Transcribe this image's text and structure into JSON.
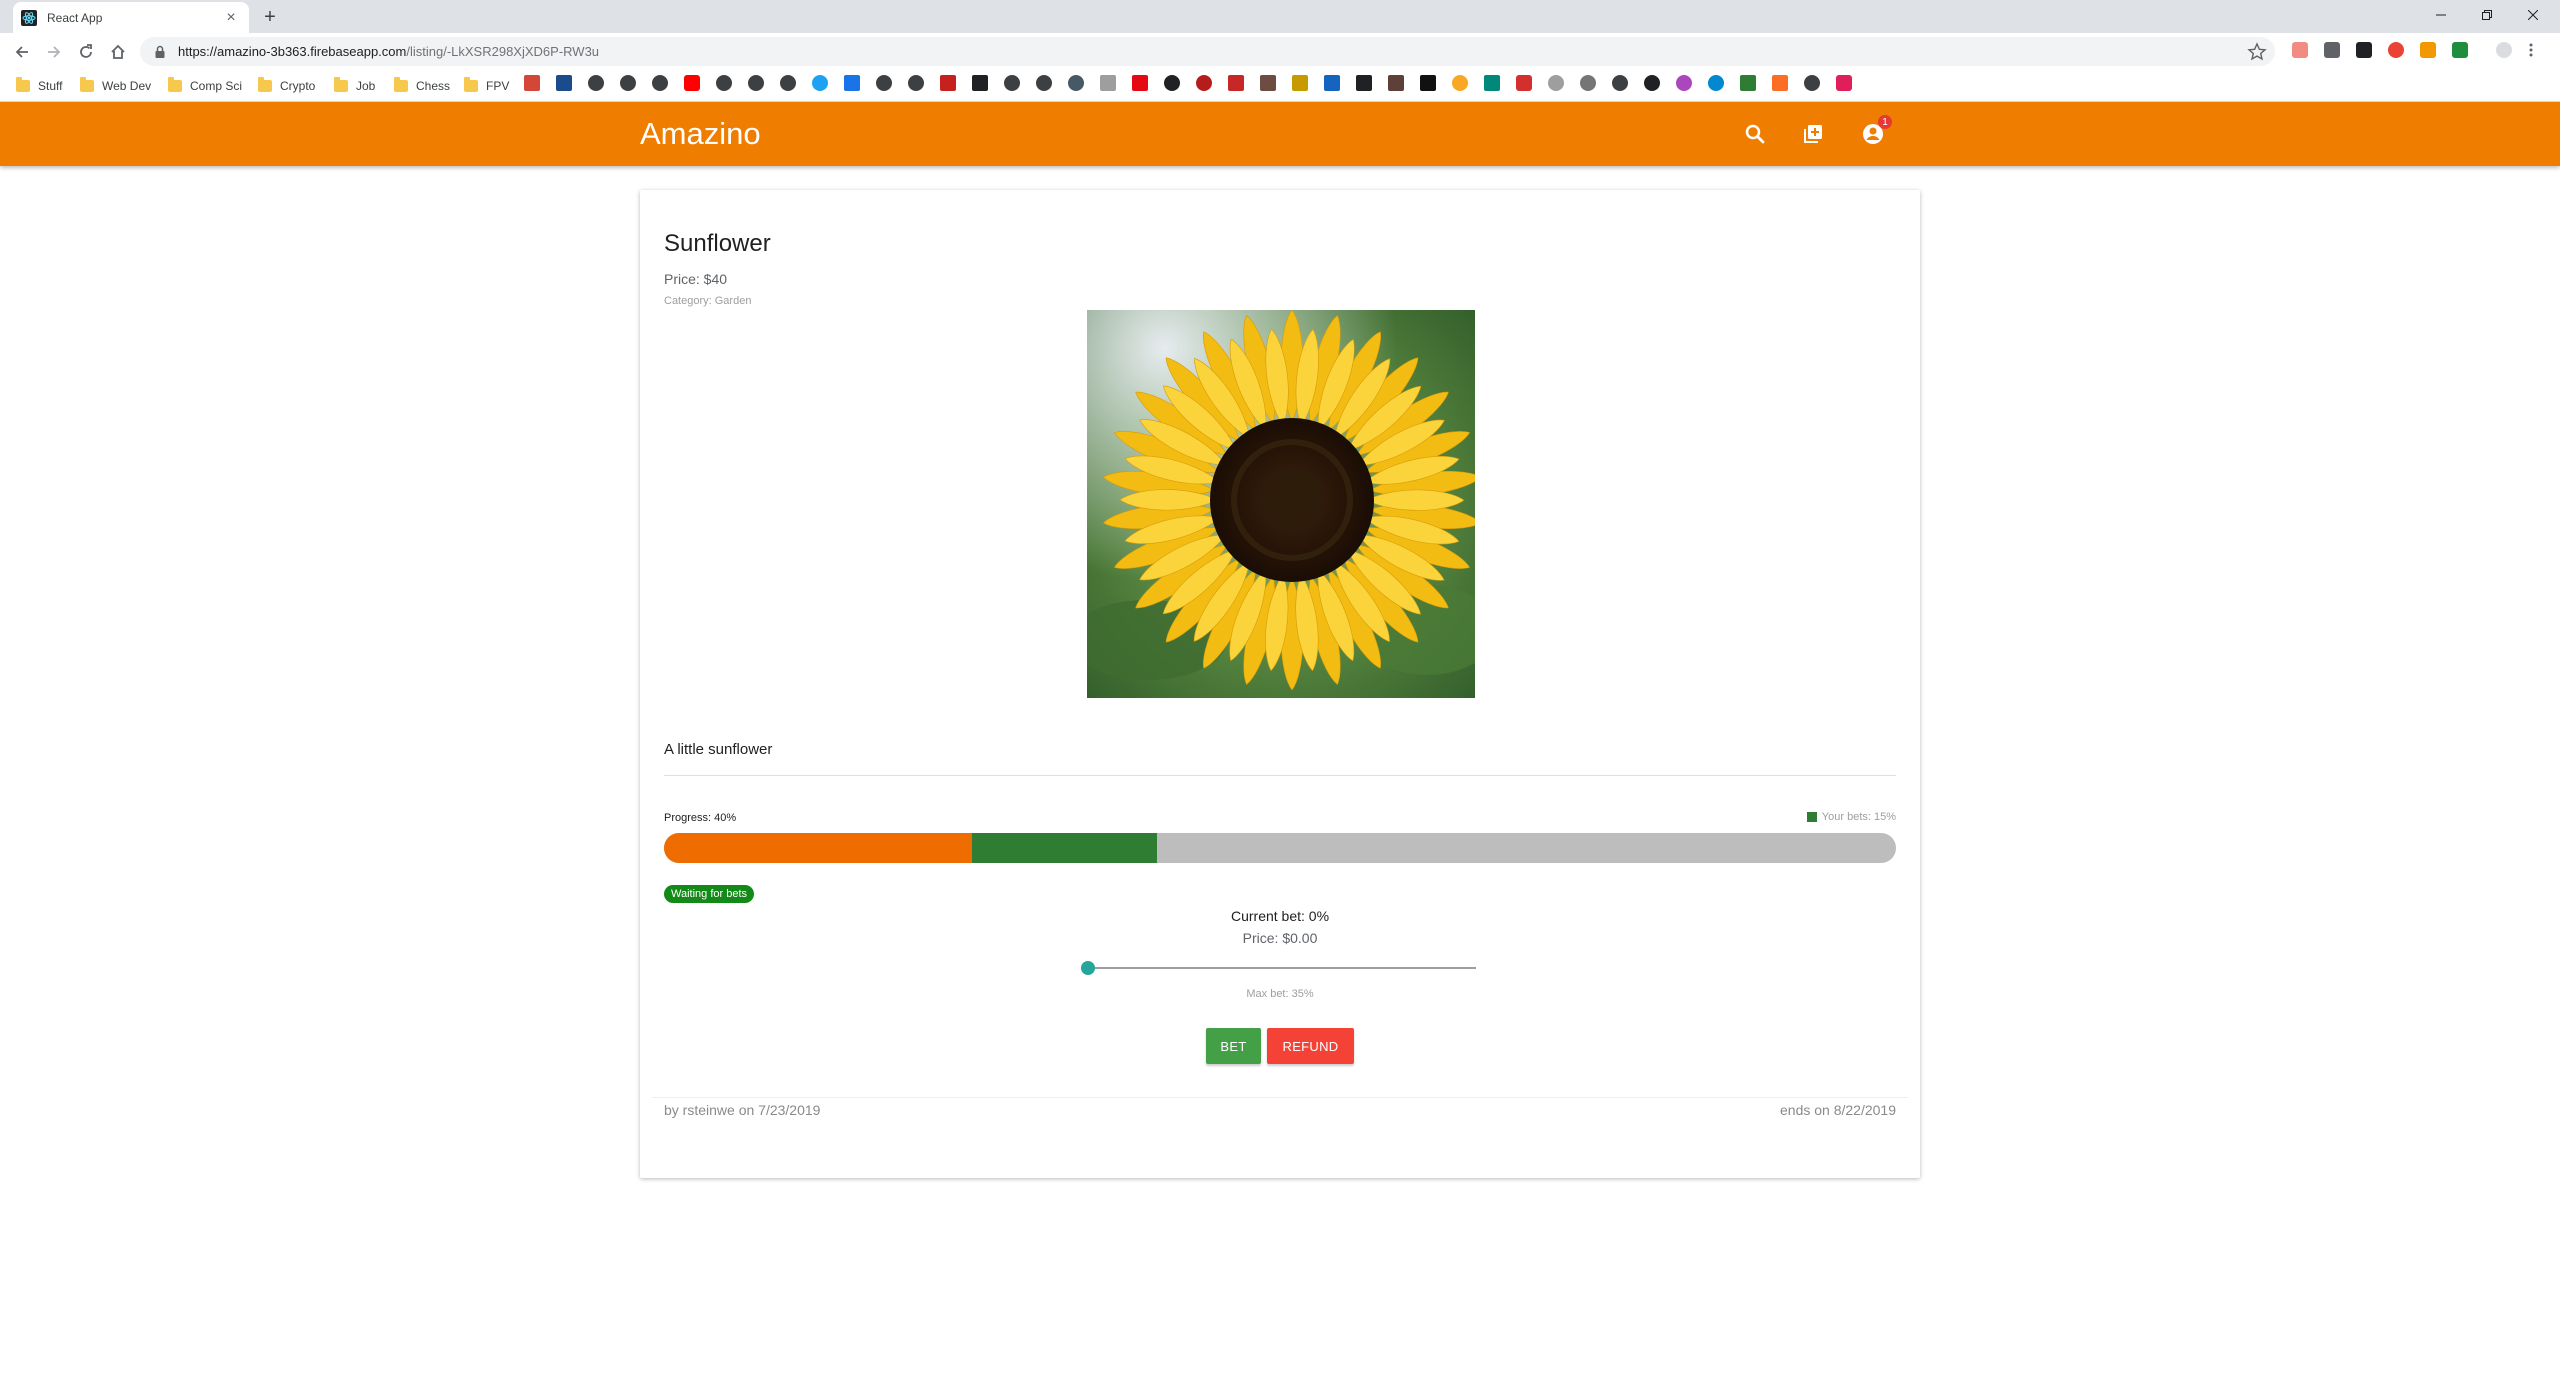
{
  "browser": {
    "tab_title": "React App",
    "tab_close": "×",
    "new_tab": "+",
    "url_host": "https://amazino-3b363.firebaseapp.com",
    "url_path": "/listing/-LkXSR298XjXD6P-RW3u",
    "bookmarks": [
      "Stuff",
      "Web Dev",
      "Comp Sci",
      "Crypto",
      "Job",
      "Chess",
      "FPV"
    ]
  },
  "app": {
    "brand": "Amazino",
    "notification_count": "1",
    "colors": {
      "primary": "#ef7d00",
      "progress": "#ef6c00",
      "your_bets": "#2e7d32",
      "bet": "#43a047",
      "refund": "#f44336",
      "slider": "#26a69a"
    }
  },
  "listing": {
    "title": "Sunflower",
    "price": "Price: $40",
    "category": "Category: Garden",
    "description": "A little sunflower",
    "progress_label": "Progress: 40%",
    "your_bets_label": "Your bets: 15%",
    "progress_fraction": 0.25,
    "your_bets_fraction": 0.15,
    "status": "Waiting for bets",
    "current_bet": "Current bet: 0%",
    "bet_price": "Price: $0.00",
    "slider_value": 0,
    "max_bet": "Max bet: 35%",
    "bet_button": "BET",
    "refund_button": "REFUND",
    "byline": "by rsteinwe on 7/23/2019",
    "ends": "ends on 8/22/2019"
  }
}
